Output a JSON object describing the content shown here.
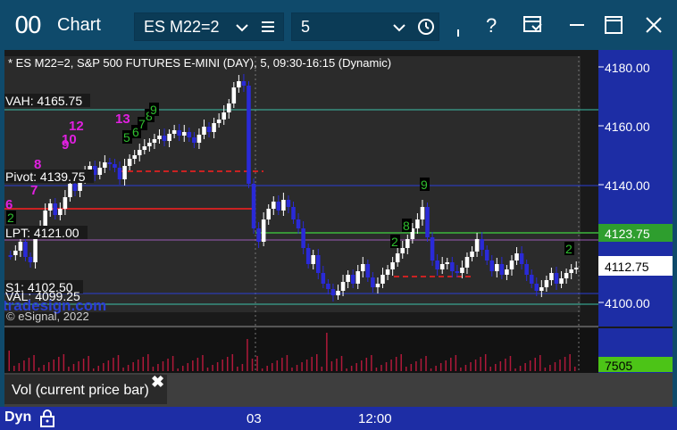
{
  "window": {
    "icon_glyph": "00",
    "title": "Chart"
  },
  "symbol_field": {
    "value": "ES M22=2"
  },
  "interval_field": {
    "value": "5"
  },
  "chart": {
    "header": "* ES M22=2, S&P 500 FUTURES E-MINI (DAY), 5, 09:30-16:15 (Dynamic)",
    "watermark": "© eSignal, 2022",
    "brand": "tradesign.com",
    "price_axis": [
      "4180.00",
      "4160.00",
      "4140.00",
      "4120.00",
      "4100.00"
    ],
    "levels": {
      "vah": "VAH: 4165.75",
      "pivot": "Pivot: 4139.75",
      "lpt": "LPT: 4121.00",
      "s1": "S1: 4102.50",
      "val": "VAL: 4099.25"
    },
    "current_price_green": "4123.75",
    "current_price": "4112.75",
    "time_axis": [
      "03",
      "12:00"
    ],
    "counts_magenta": [
      "6",
      "7",
      "8",
      "9",
      "10",
      "12",
      "13"
    ],
    "counts_green": [
      "2",
      "5",
      "6",
      "7",
      "8",
      "9",
      "2",
      "8",
      "9",
      "2"
    ],
    "colors": {
      "bar_up": "#ffffff",
      "bar_down": "#2a2ad8",
      "volume": "#b0193a",
      "vol_readout_bg": "#4cc417",
      "accent_titlebar": "#0f4a6b"
    }
  },
  "volume": {
    "readout": "7505",
    "tab_label": "Vol (current price bar)",
    "close_glyph": "✖"
  },
  "footer": {
    "label": "Dyn"
  }
}
